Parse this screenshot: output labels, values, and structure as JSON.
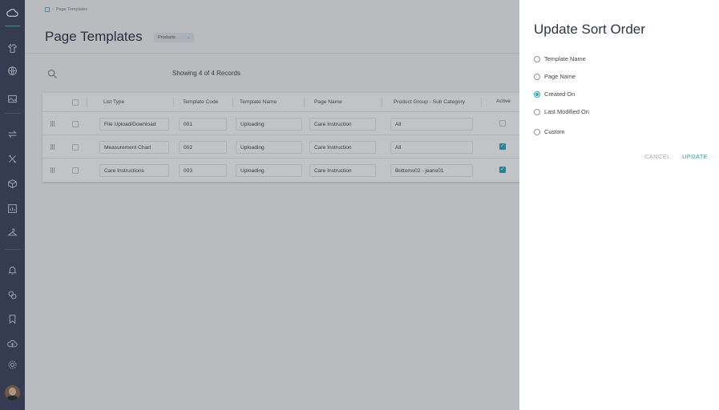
{
  "breadcrumb": "Page Templates",
  "page_title": "Page Templates",
  "group_filter": "Products",
  "records_text": "Showing 4 of 4 Records",
  "table": {
    "columns": [
      "List Type",
      "Template Code",
      "Template Name",
      "Page Name",
      "Product Group - Sub Category",
      "Active"
    ],
    "rows": [
      {
        "list_type": "File Upload/Download",
        "code": "001",
        "template_name": "Uploading",
        "page_name": "Care Instruction",
        "group": "All",
        "active": false
      },
      {
        "list_type": "Measurement Chart",
        "code": "002",
        "template_name": "Uploading",
        "page_name": "Care Instruction",
        "group": "All",
        "active": true
      },
      {
        "list_type": "Care Instructions",
        "code": "003",
        "template_name": "Uploading",
        "page_name": "Care Instruction",
        "group": "Bottoms02 - jeans01",
        "active": true
      }
    ]
  },
  "drawer": {
    "title": "Update Sort Order",
    "options": [
      {
        "label": "Template Name",
        "selected": false
      },
      {
        "label": "Page Name",
        "selected": false
      },
      {
        "label": "Created On",
        "selected": true
      },
      {
        "label": "Last Modified On",
        "selected": false
      },
      {
        "label": "Custom",
        "selected": false
      }
    ],
    "cancel_label": "CANCEL",
    "update_label": "UPDATE"
  },
  "colors": {
    "sidebar": "#3e4661",
    "accent": "#2aa7c0",
    "drawer_bg": "#ffffff"
  },
  "sidebar_icons": [
    "cloud-icon",
    "shirt-icon",
    "globe-icon",
    "image-icon",
    "transfer-icon",
    "tools-icon",
    "box-icon",
    "report-icon",
    "hanger-icon",
    "bell-icon",
    "coins-icon",
    "bookmark-icon",
    "upload-icon",
    "settings-icon"
  ]
}
